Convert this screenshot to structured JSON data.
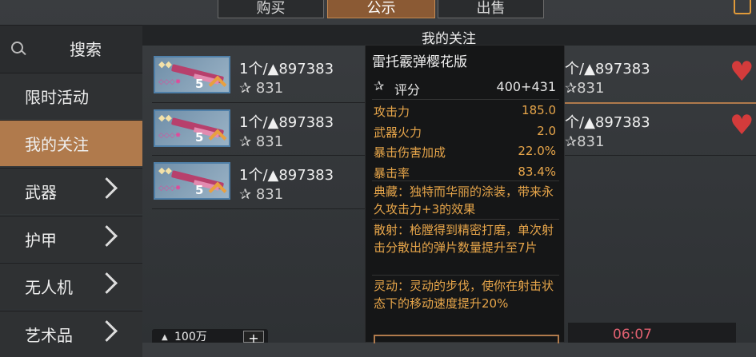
{
  "tabs": [
    "购买",
    "公示",
    "出售"
  ],
  "active_tab": "公示",
  "section_title": "我的关注",
  "search_label": "搜索",
  "sidebar": [
    {
      "label": "限时活动"
    },
    {
      "label": "我的关注"
    },
    {
      "label": "武器"
    },
    {
      "label": "护甲"
    },
    {
      "label": "无人机"
    },
    {
      "label": "艺术品"
    }
  ],
  "items": [
    {
      "price": "1个/▲897383",
      "rating": "831",
      "level": "5"
    },
    {
      "price": "1个/▲897383",
      "rating": "831",
      "level": "5"
    },
    {
      "price": "1个/▲897383",
      "rating": "831",
      "level": "5"
    }
  ],
  "right_items": [
    {
      "price": "个/▲897383",
      "rating": "831"
    },
    {
      "price": "个/▲897383",
      "rating": "831"
    }
  ],
  "popup": {
    "name": "雷托霰弹樱花版",
    "score_label": "评分",
    "score_value": "400+431",
    "stats": [
      {
        "k": "攻击力",
        "v": "185.0"
      },
      {
        "k": "武器火力",
        "v": "2.0"
      },
      {
        "k": "暴击伤害加成",
        "v": "22.0%"
      },
      {
        "k": "暴击率",
        "v": "83.4%"
      }
    ],
    "desc1": "典藏：独特而华丽的涂装，带来永久攻击力+3的效果",
    "desc2": "散射：枪膛得到精密打磨，单次射击分散出的弹片数量提升至7片",
    "desc3": "灵动：灵动的步伐，使你在射击状态下的移动速度提升20%"
  },
  "bottom": {
    "amount": "100万",
    "plus": "+"
  },
  "timer": "06:07",
  "colors": {
    "accent": "#b07a4c",
    "stat_text": "#e8a64a",
    "heart": "#d43b3b"
  }
}
